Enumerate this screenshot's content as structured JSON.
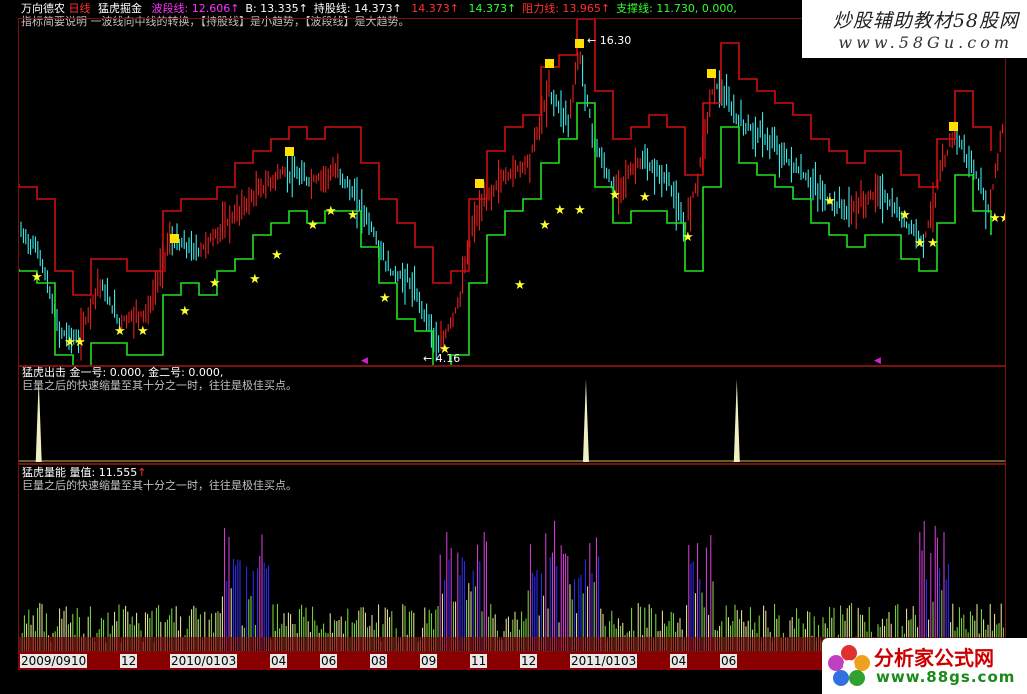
{
  "header": {
    "app": "万向德农",
    "period": "日线",
    "indicator": "猛虎掘金",
    "values": [
      {
        "label": "波段线:",
        "value": "12.606",
        "arrow": "↑",
        "color": "#ff30ff"
      },
      {
        "label": "B:",
        "value": "13.335",
        "arrow": "↑",
        "color": "#ffffff"
      },
      {
        "label": "持股线:",
        "value": "14.373",
        "arrow": "↑",
        "color": "#ffffff"
      },
      {
        "label": "",
        "value": "14.373",
        "arrow": "↑",
        "color": "#ff3030"
      },
      {
        "label": "",
        "value": "14.373",
        "arrow": "↑",
        "color": "#30ff30"
      },
      {
        "label": "阻力线:",
        "value": "13.965",
        "arrow": "↑",
        "color": "#ff3030"
      },
      {
        "label": "支撑线:",
        "value": "11.730, 0.000,",
        "arrow": "",
        "color": "#30ff30"
      }
    ],
    "note": "指标简要说明 一波线向中线的转换，【持股线】是小趋势，【波段线】是大趋势。",
    "annotations": {
      "high": "16.30",
      "low": "4.16"
    }
  },
  "panel2": {
    "title": "猛虎出击",
    "values": "金一号: 0.000, 金二号: 0.000,",
    "desc": "巨量之后的快速缩量至其十分之一时，往往是极佳买点。",
    "spikes": [
      0.02,
      0.575,
      0.728
    ]
  },
  "panel3": {
    "title": "猛虎量能",
    "value": "量值: 11.555",
    "arrow": "↑",
    "desc": "巨量之后的快速缩量至其十分之一时，往往是极佳买点。"
  },
  "dates": [
    "2009/09",
    "10",
    "12",
    "2010/01",
    "03",
    "04",
    "06",
    "08",
    "09",
    "11",
    "12",
    "2011/01",
    "03",
    "04",
    "06"
  ],
  "watermarks": {
    "top_title": "炒股辅助教材58股网",
    "top_url": "www.58Gu.com",
    "bottom_title": "分析家公式网",
    "bottom_url": "www.88gs.com"
  },
  "colors": {
    "up": "#ff2020",
    "down": "#40ffff",
    "support": "#20e020",
    "resistance": "#d01010",
    "star": "#ffff30",
    "volume_hi": "#e040e0",
    "volume_mid": "#3030ff",
    "volume_lo": "#f0f0a0"
  }
}
